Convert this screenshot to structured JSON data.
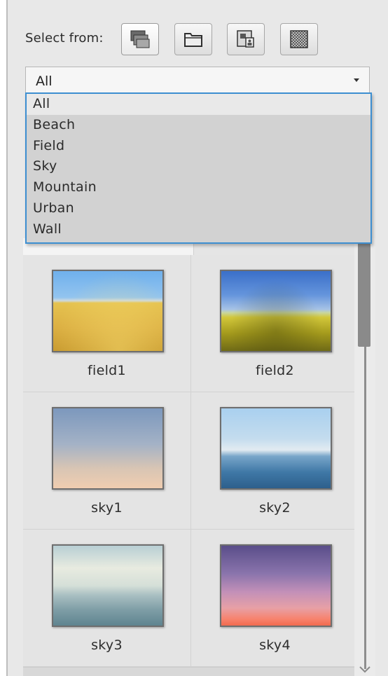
{
  "toolbar": {
    "select_from_label": "Select from:",
    "buttons": [
      {
        "name": "layers-source-icon",
        "active": true
      },
      {
        "name": "folder-source-icon",
        "active": false
      },
      {
        "name": "image-source-icon",
        "active": false
      },
      {
        "name": "pattern-source-icon",
        "active": false
      }
    ]
  },
  "combo": {
    "selected": "All",
    "options": [
      "All",
      "Beach",
      "Field",
      "Sky",
      "Mountain",
      "Urban",
      "Wall"
    ]
  },
  "thumbnails": [
    {
      "label": "field1"
    },
    {
      "label": "field2"
    },
    {
      "label": "sky1"
    },
    {
      "label": "sky2"
    },
    {
      "label": "sky3"
    },
    {
      "label": "sky4"
    }
  ],
  "colors": {
    "dropdown_border": "#3d8fd1",
    "panel_bg": "#e8e8e8",
    "dropdown_bg": "#d2d2d2"
  }
}
